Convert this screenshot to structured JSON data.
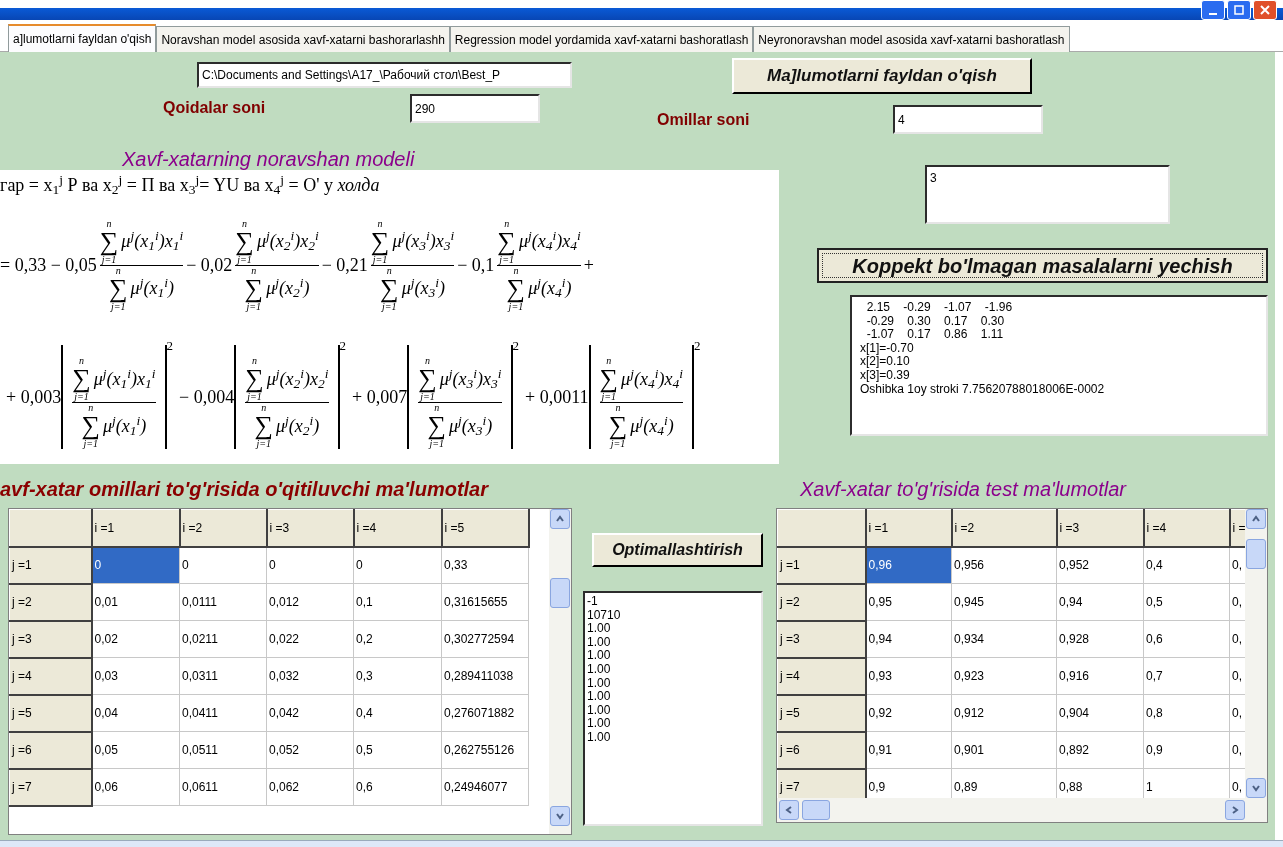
{
  "tabs": [
    {
      "label": "a]lumotlarni fayldan o'qish",
      "selected": true
    },
    {
      "label": "Noravshan model asosida xavf-xatarni bashorarlashh",
      "selected": false
    },
    {
      "label": "Regression model yordamida xavf-xatarni bashoratlash",
      "selected": false
    },
    {
      "label": "Neyronoravshan model asosida xavf-xatarni bashoratlash",
      "selected": false
    }
  ],
  "file_path": "C:\\Documents and Settings\\A17_\\Рабочий стол\\Best_P",
  "read_button": "Ma]lumotlarni fayldan o'qish",
  "rules_label": "Qoidalar soni",
  "rules_value": "290",
  "factors_label": "Omillar soni",
  "factors_value": "4",
  "model_heading": "Xavf-xatarning noravshan modeli",
  "formula": {
    "condition": "гар = x$_{1}$$^{j}$  Р  ва x$_{2}$$^{j}$  = П  ва  x$_{3}$$^{j}$= YU  ва x$_{4}$$^{j}$   = O'   у  *холда*",
    "linear_terms": [
      {
        "coef": "= 0,33 − 0,05",
        "num": {
          "upper": "n",
          "sigma": "∑",
          "lower": "j=1",
          "body": "μ$^{j}$(x$_{1}$$^{i}$)x$_{1}$$^{i}$"
        },
        "den": {
          "upper": "n",
          "sigma": "∑",
          "lower": "j=1",
          "body": "μ$^{j}$(x$_{1}$$^{i}$)"
        }
      },
      {
        "coef": "− 0,02",
        "num": {
          "upper": "n",
          "sigma": "∑",
          "lower": "j=1",
          "body": "μ$^{j}$(x$_{2}$$^{i}$)x$_{2}$$^{i}$"
        },
        "den": {
          "upper": "n",
          "sigma": "∑",
          "lower": "j=1",
          "body": "μ$^{j}$(x$_{2}$$^{i}$)"
        }
      },
      {
        "coef": "− 0,21",
        "num": {
          "upper": "n",
          "sigma": "∑",
          "lower": "j=1",
          "body": "μ$^{j}$(x$_{3}$$^{i}$)x$_{3}$$^{i}$"
        },
        "den": {
          "upper": "n",
          "sigma": "∑",
          "lower": "j=1",
          "body": "μ$^{j}$(x$_{3}$$^{i}$)"
        }
      },
      {
        "coef": "− 0,1",
        "num": {
          "upper": "n",
          "sigma": "∑",
          "lower": "j=1",
          "body": "μ$^{j}$(x$_{4}$$^{i}$)x$_{4}$$^{i}$"
        },
        "den": {
          "upper": "n",
          "sigma": "∑",
          "lower": "j=1",
          "body": "μ$^{j}$(x$_{4}$$^{i}$)"
        }
      }
    ],
    "linear_tail": "+",
    "square_terms": [
      {
        "coef": "+ 0,003",
        "power": "2",
        "num": {
          "upper": "n",
          "sigma": "∑",
          "lower": "j=1",
          "body": "μ$^{j}$(x$_{1}$$^{i}$)x$_{1}$$^{i}$"
        },
        "den": {
          "upper": "n",
          "sigma": "∑",
          "lower": "j=1",
          "body": "μ$^{j}$(x$_{1}$$^{i}$)"
        }
      },
      {
        "coef": "− 0,004",
        "power": "2",
        "num": {
          "upper": "n",
          "sigma": "∑",
          "lower": "j=1",
          "body": "μ$^{j}$(x$_{2}$$^{i}$)x$_{2}$$^{i}$"
        },
        "den": {
          "upper": "n",
          "sigma": "∑",
          "lower": "j=1",
          "body": "μ$^{j}$(x$_{2}$$^{i}$)"
        }
      },
      {
        "coef": "+ 0,007",
        "power": "2",
        "num": {
          "upper": "n",
          "sigma": "∑",
          "lower": "j=1",
          "body": "μ$^{j}$(x$_{3}$$^{i}$)x$_{3}$$^{i}$"
        },
        "den": {
          "upper": "n",
          "sigma": "∑",
          "lower": "j=1",
          "body": "μ$^{j}$(x$_{3}$$^{i}$)"
        }
      },
      {
        "coef": "+ 0,0011",
        "power": "2",
        "num": {
          "upper": "n",
          "sigma": "∑",
          "lower": "j=1",
          "body": "μ$^{j}$(x$_{4}$$^{i}$)x$_{4}$$^{i}$"
        },
        "den": {
          "upper": "n",
          "sigma": "∑",
          "lower": "j=1",
          "body": "μ$^{j}$(x$_{4}$$^{i}$)"
        }
      }
    ]
  },
  "small_memo": "3",
  "solve_button": "Koppekt bo'lmagan masalalarni yechish",
  "solve_output": [
    "  2.15    -0.29    -1.07    -1.96",
    "  -0.29    0.30    0.17    0.30",
    "  -1.07    0.17    0.86    1.11",
    "x[1]=-0.70",
    "x[2]=0.10",
    "x[3]=0.39",
    "Oshibka 1oy stroki 7.75620788018006E-0002"
  ],
  "training_heading": "avf-xatar omillari  to'g'risida o'qitiluvchi ma'lumotlar",
  "test_heading": "Xavf-xatar to'g'risida test ma'lumotlar",
  "training_table": {
    "columns": [
      "i =1",
      "i =2",
      "i =3",
      "i =4",
      "i =5"
    ],
    "rows": [
      {
        "header": "j =1",
        "cells": [
          {
            "text": "0",
            "selected": true
          },
          {
            "text": "0",
            "selected": false
          },
          {
            "text": "0",
            "selected": false
          },
          {
            "text": "0",
            "selected": false
          },
          {
            "text": "0,33",
            "selected": false
          }
        ]
      },
      {
        "header": "j =2",
        "cells": [
          {
            "text": "0,01",
            "selected": false
          },
          {
            "text": "0,0111",
            "selected": false
          },
          {
            "text": "0,012",
            "selected": false
          },
          {
            "text": "0,1",
            "selected": false
          },
          {
            "text": "0,31615655",
            "selected": false
          }
        ]
      },
      {
        "header": "j =3",
        "cells": [
          {
            "text": "0,02",
            "selected": false
          },
          {
            "text": "0,0211",
            "selected": false
          },
          {
            "text": "0,022",
            "selected": false
          },
          {
            "text": "0,2",
            "selected": false
          },
          {
            "text": "0,302772594",
            "selected": false
          }
        ]
      },
      {
        "header": "j =4",
        "cells": [
          {
            "text": "0,03",
            "selected": false
          },
          {
            "text": "0,0311",
            "selected": false
          },
          {
            "text": "0,032",
            "selected": false
          },
          {
            "text": "0,3",
            "selected": false
          },
          {
            "text": "0,289411038",
            "selected": false
          }
        ]
      },
      {
        "header": "j =5",
        "cells": [
          {
            "text": "0,04",
            "selected": false
          },
          {
            "text": "0,0411",
            "selected": false
          },
          {
            "text": "0,042",
            "selected": false
          },
          {
            "text": "0,4",
            "selected": false
          },
          {
            "text": "0,276071882",
            "selected": false
          }
        ]
      },
      {
        "header": "j =6",
        "cells": [
          {
            "text": "0,05",
            "selected": false
          },
          {
            "text": "0,0511",
            "selected": false
          },
          {
            "text": "0,052",
            "selected": false
          },
          {
            "text": "0,5",
            "selected": false
          },
          {
            "text": "0,262755126",
            "selected": false
          }
        ]
      },
      {
        "header": "j =7",
        "cells": [
          {
            "text": "0,06",
            "selected": false
          },
          {
            "text": "0,0611",
            "selected": false
          },
          {
            "text": "0,062",
            "selected": false
          },
          {
            "text": "0,6",
            "selected": false
          },
          {
            "text": "0,24946077",
            "selected": false
          }
        ]
      }
    ]
  },
  "optimize_button": "Optimallashtirish",
  "optimize_output": [
    "-1",
    "10710",
    "1.00",
    "1.00",
    "1.00",
    "1.00",
    "1.00",
    "1.00",
    "1.00",
    "1.00",
    "1.00"
  ],
  "test_table": {
    "columns": [
      "i =1",
      "i =2",
      "i =3",
      "i =4",
      "i ="
    ],
    "rows": [
      {
        "header": "j =1",
        "cells": [
          {
            "text": "0,96",
            "selected": true
          },
          {
            "text": "0,956",
            "selected": false
          },
          {
            "text": "0,952",
            "selected": false
          },
          {
            "text": "0,4",
            "selected": false
          },
          {
            "text": "0,",
            "selected": false
          }
        ]
      },
      {
        "header": "j =2",
        "cells": [
          {
            "text": "0,95",
            "selected": false
          },
          {
            "text": "0,945",
            "selected": false
          },
          {
            "text": "0,94",
            "selected": false
          },
          {
            "text": "0,5",
            "selected": false
          },
          {
            "text": "0,",
            "selected": false
          }
        ]
      },
      {
        "header": "j =3",
        "cells": [
          {
            "text": "0,94",
            "selected": false
          },
          {
            "text": "0,934",
            "selected": false
          },
          {
            "text": "0,928",
            "selected": false
          },
          {
            "text": "0,6",
            "selected": false
          },
          {
            "text": "0,",
            "selected": false
          }
        ]
      },
      {
        "header": "j =4",
        "cells": [
          {
            "text": "0,93",
            "selected": false
          },
          {
            "text": "0,923",
            "selected": false
          },
          {
            "text": "0,916",
            "selected": false
          },
          {
            "text": "0,7",
            "selected": false
          },
          {
            "text": "0,",
            "selected": false
          }
        ]
      },
      {
        "header": "j =5",
        "cells": [
          {
            "text": "0,92",
            "selected": false
          },
          {
            "text": "0,912",
            "selected": false
          },
          {
            "text": "0,904",
            "selected": false
          },
          {
            "text": "0,8",
            "selected": false
          },
          {
            "text": "0,",
            "selected": false
          }
        ]
      },
      {
        "header": "j =6",
        "cells": [
          {
            "text": "0,91",
            "selected": false
          },
          {
            "text": "0,901",
            "selected": false
          },
          {
            "text": "0,892",
            "selected": false
          },
          {
            "text": "0,9",
            "selected": false
          },
          {
            "text": "0,",
            "selected": false
          }
        ]
      },
      {
        "header": "j =7",
        "cells": [
          {
            "text": "0,9",
            "selected": false
          },
          {
            "text": "0,89",
            "selected": false
          },
          {
            "text": "0,88",
            "selected": false
          },
          {
            "text": "1",
            "selected": false
          },
          {
            "text": "0,",
            "selected": false
          }
        ]
      }
    ]
  }
}
